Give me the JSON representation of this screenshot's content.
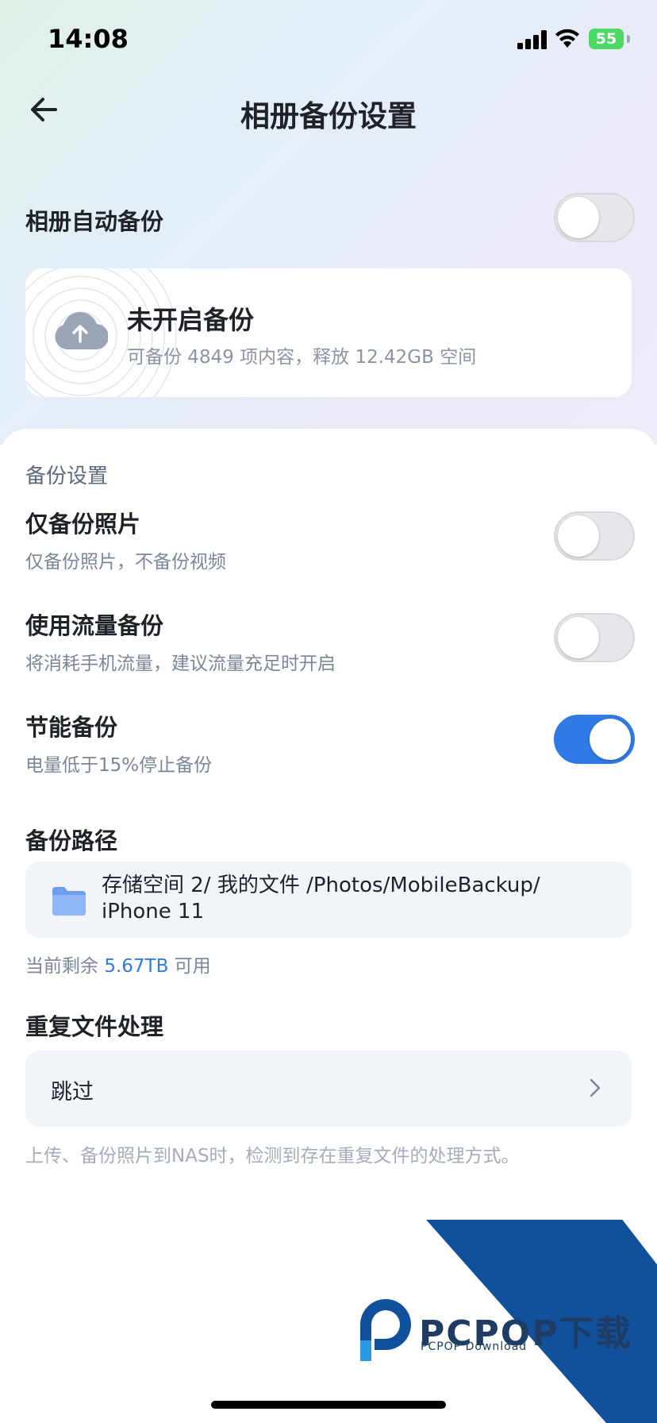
{
  "status": {
    "time": "14:08",
    "battery": "55"
  },
  "header": {
    "title": "相册备份设置"
  },
  "auto_backup": {
    "label": "相册自动备份",
    "enabled": false
  },
  "status_card": {
    "title": "未开启备份",
    "subtitle": "可备份 4849 项内容，释放 12.42GB 空间"
  },
  "settings": {
    "section_title": "备份设置",
    "items": [
      {
        "title": "仅备份照片",
        "subtitle": "仅备份照片，不备份视频",
        "enabled": false
      },
      {
        "title": "使用流量备份",
        "subtitle": "将消耗手机流量，建议流量充足时开启",
        "enabled": false
      },
      {
        "title": "节能备份",
        "subtitle": "电量低于15%停止备份",
        "enabled": true
      }
    ]
  },
  "backup_path": {
    "label": "备份路径",
    "path_line1": "存储空间 2/ 我的文件 /Photos/MobileBackup/",
    "path_line2": "iPhone 11",
    "remain_prefix": "当前剩余",
    "remain_value": "5.67TB",
    "remain_suffix": "可用"
  },
  "duplicate": {
    "label": "重复文件处理",
    "value": "跳过",
    "note": "上传、备份照片到NAS时，检测到存在重复文件的处理方式。"
  },
  "watermark": {
    "brand": "PCPOP下载",
    "sub": "PCPOP Download"
  },
  "colors": {
    "accent": "#2f7ae5",
    "toggle_off": "#e6e7ea"
  }
}
